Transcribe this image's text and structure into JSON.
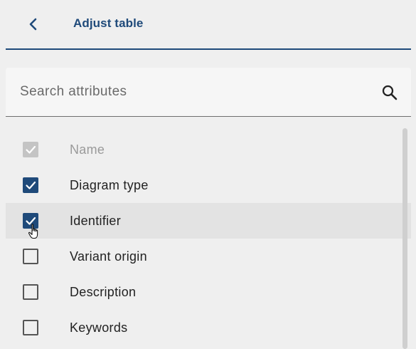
{
  "header": {
    "title": "Adjust table"
  },
  "search": {
    "placeholder": "Search attributes",
    "value": ""
  },
  "attributes": [
    {
      "label": "Name",
      "checked": true,
      "disabled": true
    },
    {
      "label": "Diagram type",
      "checked": true,
      "disabled": false
    },
    {
      "label": "Identifier",
      "checked": true,
      "disabled": false,
      "hovered": true
    },
    {
      "label": "Variant origin",
      "checked": false,
      "disabled": false
    },
    {
      "label": "Description",
      "checked": false,
      "disabled": false
    },
    {
      "label": "Keywords",
      "checked": false,
      "disabled": false
    }
  ],
  "colors": {
    "accent": "#1f4a7a",
    "disabled": "#c4c4c4",
    "background": "#efefef",
    "hover_row": "#e3e3e3"
  }
}
